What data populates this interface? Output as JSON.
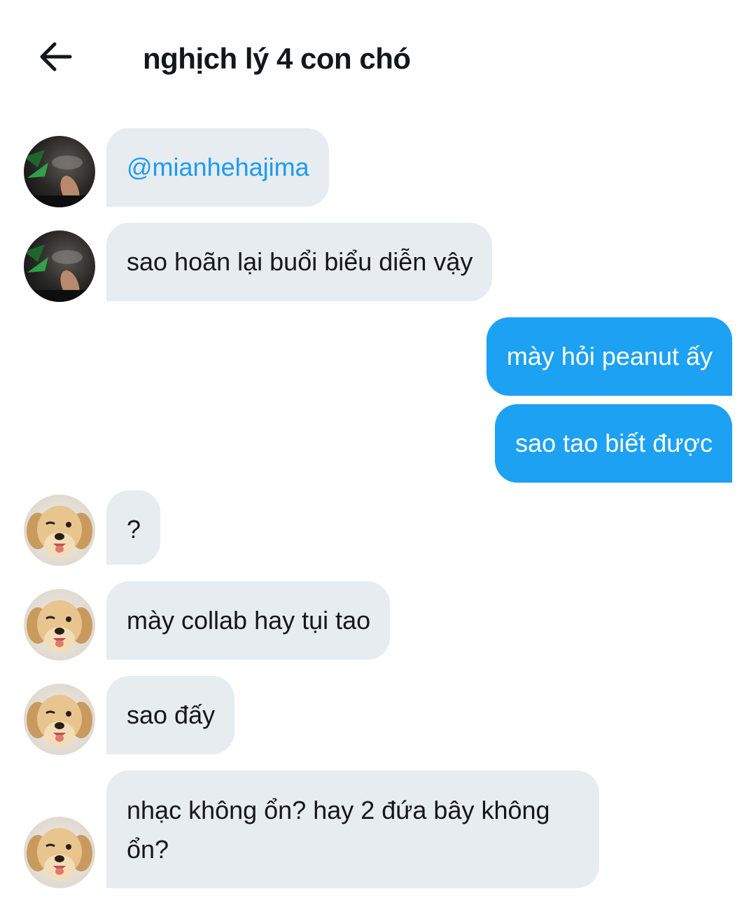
{
  "header": {
    "title": "nghịch lý 4 con chó"
  },
  "messages": [
    {
      "text": "@mianhehajima"
    },
    {
      "text": "sao hoãn lại buổi biểu diễn vậy"
    },
    {
      "text": "mày hỏi peanut ấy"
    },
    {
      "text": "sao tao biết được"
    },
    {
      "text": "?"
    },
    {
      "text": "mày collab hay tụi tao"
    },
    {
      "text": "sao đấy"
    },
    {
      "text": "nhạc không ổn? hay 2 đứa bây không ổn?"
    }
  ],
  "colors": {
    "incoming_bubble": "#e6ecf0",
    "outgoing_bubble": "#1da1f2",
    "mention_text": "#1d9bf0",
    "title_text": "#14171a"
  },
  "icons": {
    "back": "arrow-left-icon"
  }
}
